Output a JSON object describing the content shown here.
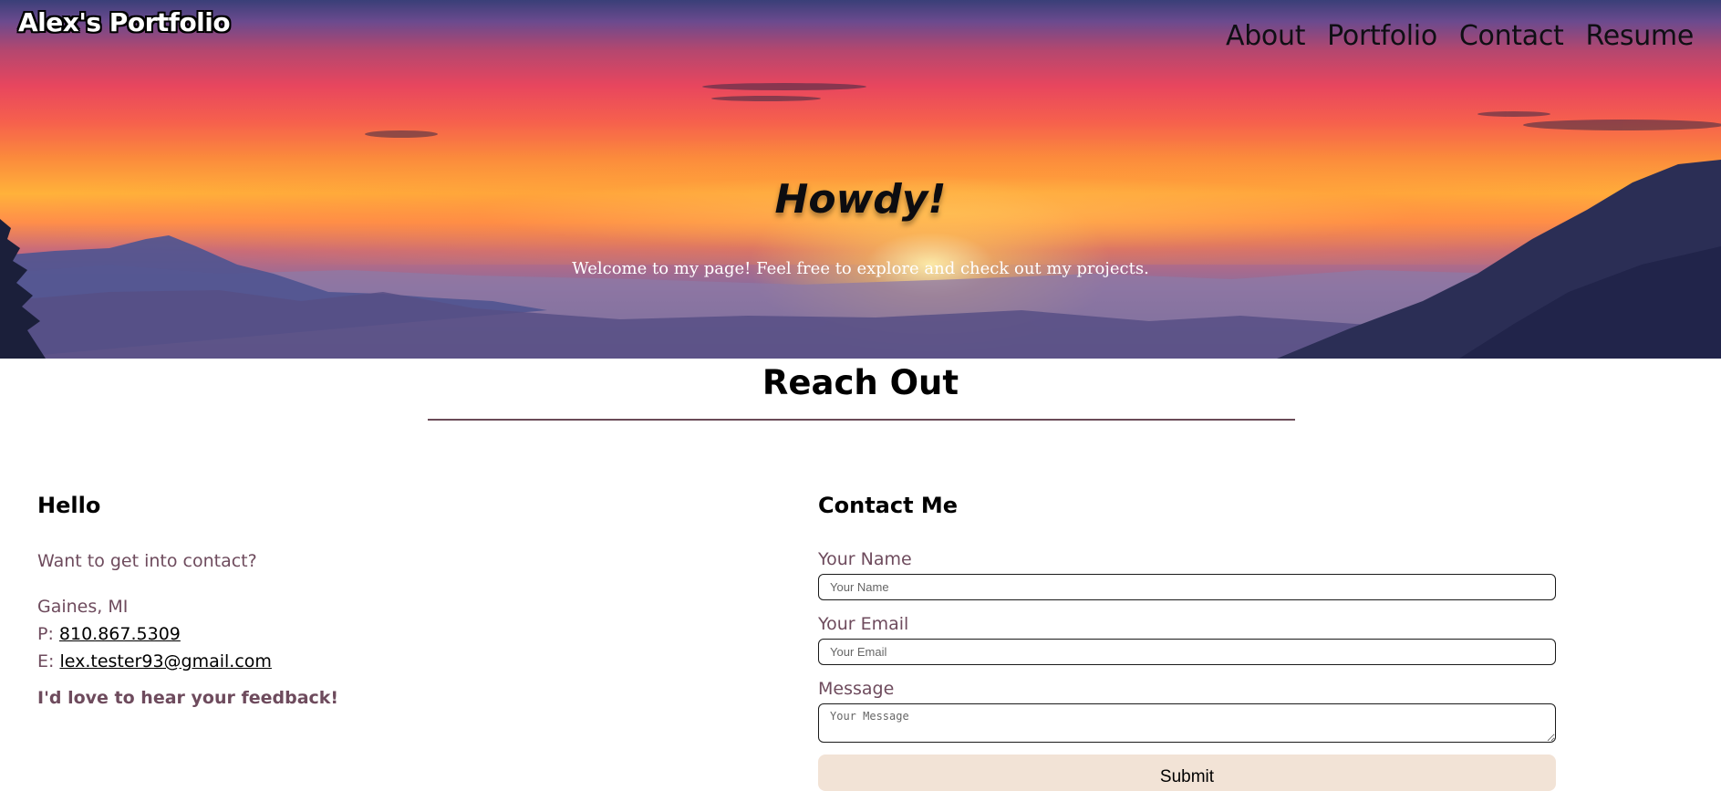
{
  "header": {
    "brand": "Alex's Portfolio",
    "nav": [
      "About",
      "Portfolio",
      "Contact",
      "Resume"
    ]
  },
  "hero": {
    "title": "Howdy!",
    "subtitle": "Welcome to my page! Feel free to explore and check out my projects."
  },
  "section": {
    "title": "Reach Out"
  },
  "hello": {
    "heading": "Hello",
    "lead": "Want to get into contact?",
    "location": "Gaines, MI",
    "phone_prefix": "P: ",
    "phone": "810.867.5309",
    "email_prefix": "E: ",
    "email": "lex.tester93@gmail.com",
    "feedback": "I'd love to hear your feedback!"
  },
  "contact_form": {
    "heading": "Contact Me",
    "name_label": "Your Name",
    "name_placeholder": "Your Name",
    "email_label": "Your Email",
    "email_placeholder": "Your Email",
    "message_label": "Message",
    "message_placeholder": "Your Message",
    "submit_label": "Submit"
  },
  "colors": {
    "accent_text": "#6e4b5d",
    "rule": "#6a4b57",
    "submit_bg": "#f2e3d6"
  }
}
